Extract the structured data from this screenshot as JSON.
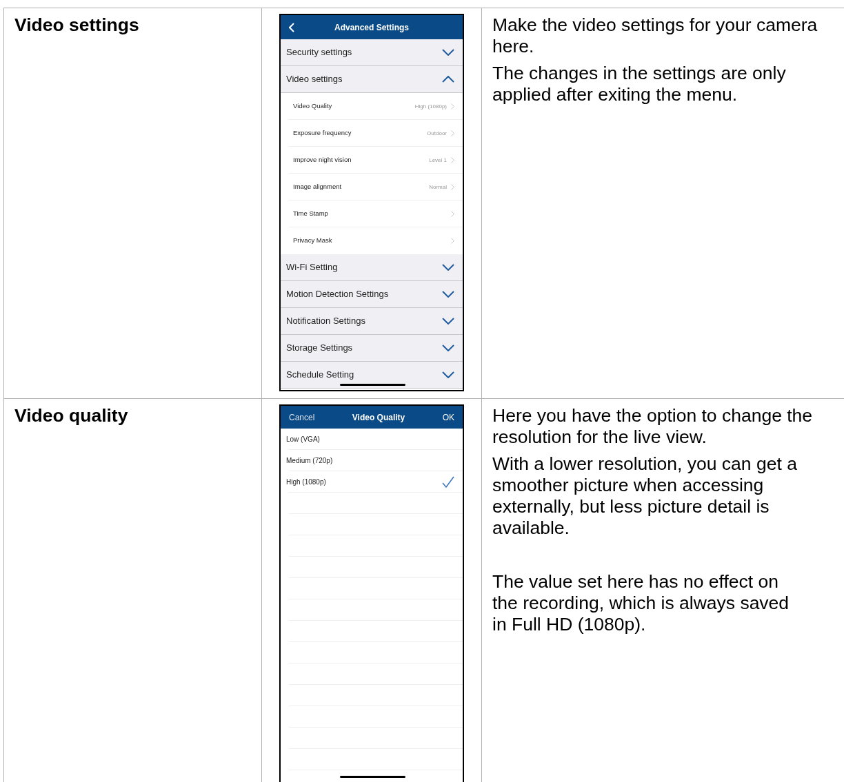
{
  "rows": [
    {
      "title": "Video settings",
      "screen": {
        "kind": "settings_menu",
        "header": {
          "title": "Advanced Settings"
        },
        "groups": [
          {
            "label": "Security settings",
            "expanded": false
          },
          {
            "label": "Video settings",
            "expanded": true,
            "children": [
              {
                "label": "Video Quality",
                "value": "High (1080p)"
              },
              {
                "label": "Exposure frequency",
                "value": "Outdoor"
              },
              {
                "label": "Improve night vision",
                "value": "Level 1"
              },
              {
                "label": "Image alignment",
                "value": "Normal"
              },
              {
                "label": "Time Stamp"
              },
              {
                "label": "Privacy Mask"
              }
            ]
          },
          {
            "label": "Wi-Fi Setting",
            "expanded": false
          },
          {
            "label": "Motion Detection Settings",
            "expanded": false
          },
          {
            "label": "Notification Settings",
            "expanded": false
          },
          {
            "label": "Storage Settings",
            "expanded": false
          },
          {
            "label": "Schedule Setting",
            "expanded": false
          }
        ]
      },
      "paragraphs": [
        "Make the video settings for your camera here.",
        "The changes in the settings are only applied after exiting the menu."
      ]
    },
    {
      "title": "Video quality",
      "screen": {
        "kind": "picker",
        "header": {
          "cancel": "Cancel",
          "title": "Video Quality",
          "ok": "OK"
        },
        "options": [
          {
            "label": "Low (VGA)",
            "selected": false
          },
          {
            "label": "Medium (720p)",
            "selected": false
          },
          {
            "label": "High (1080p)",
            "selected": true
          }
        ]
      },
      "paragraphs": [
        "Here you have the option to change the resolution for the live view.",
        "With a lower resolution, you can get a smoother picture when accessing externally, but less picture detail is available.",
        "The value set here has no effect on\nthe recording, which is always saved\nin Full HD (1080p)."
      ]
    }
  ]
}
